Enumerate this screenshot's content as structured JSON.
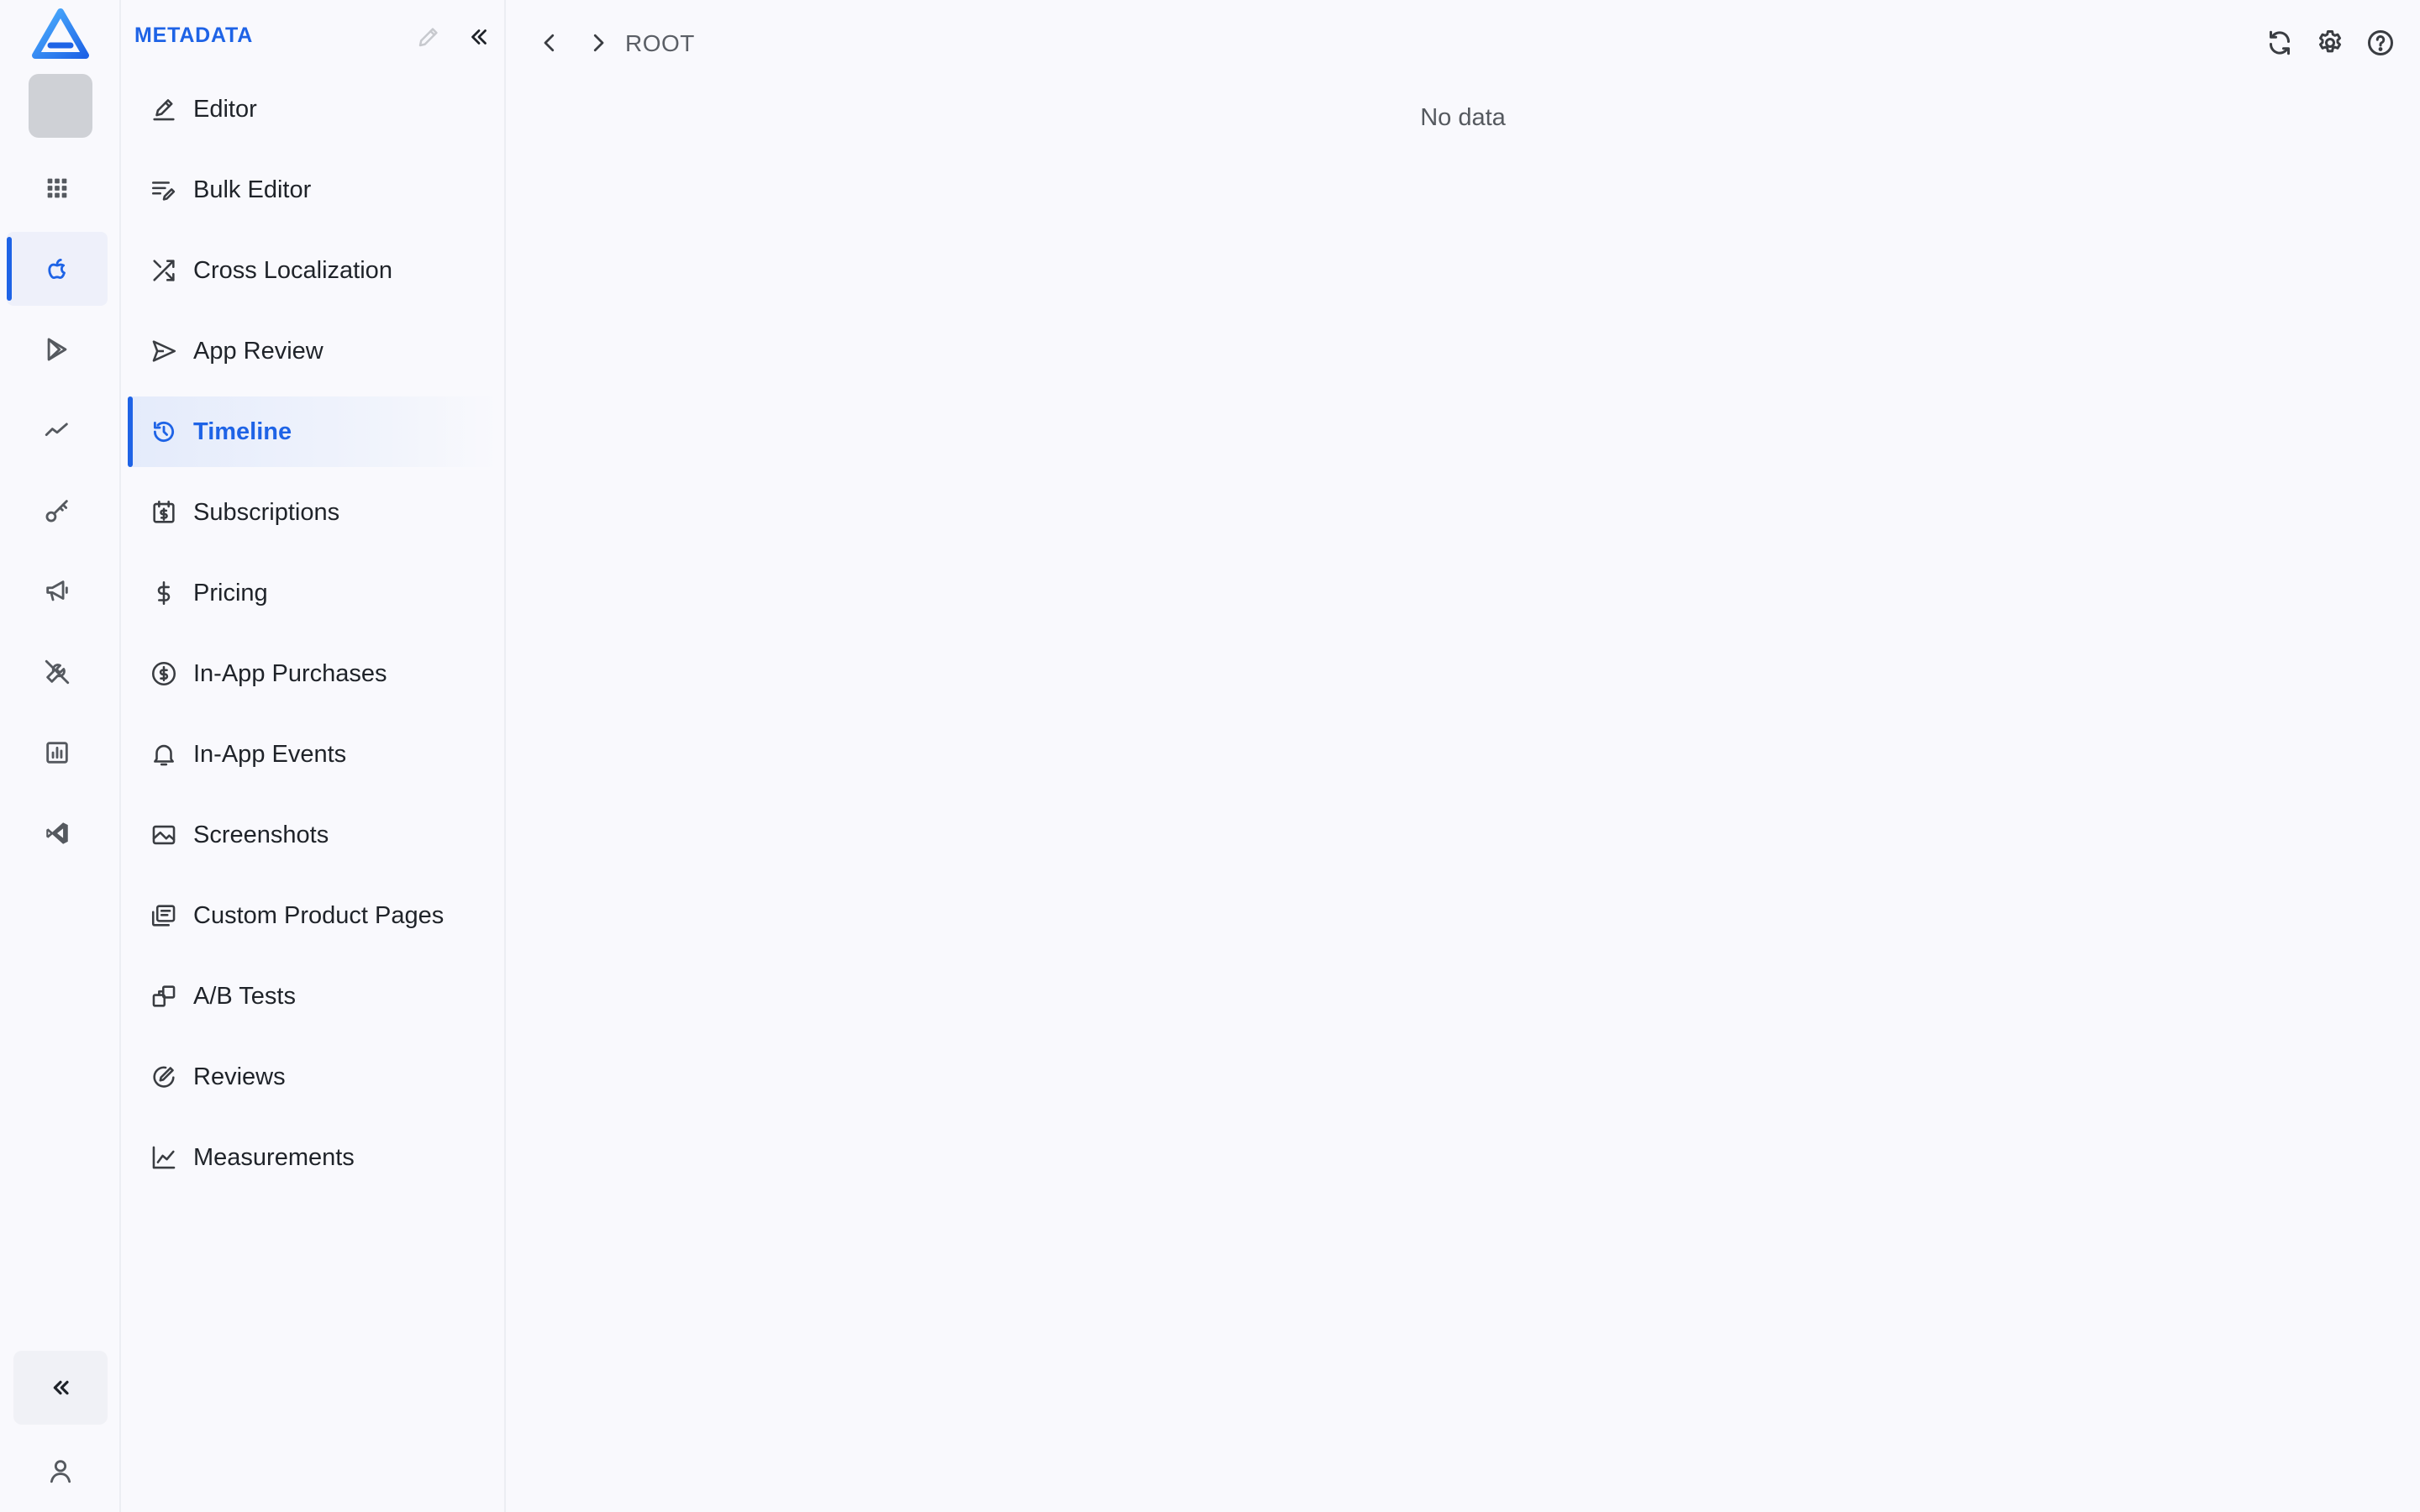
{
  "rail": {
    "logo_icon": "app-logo-icon",
    "items": [
      {
        "icon": "grid-icon",
        "active": false
      },
      {
        "icon": "apple-icon",
        "active": true
      },
      {
        "icon": "google-play-icon",
        "active": false
      },
      {
        "icon": "trend-icon",
        "active": false
      },
      {
        "icon": "key-icon",
        "active": false
      },
      {
        "icon": "megaphone-icon",
        "active": false
      },
      {
        "icon": "tools-icon",
        "active": false
      },
      {
        "icon": "bar-chart-icon",
        "active": false
      },
      {
        "icon": "vscode-icon",
        "active": false
      }
    ],
    "collapse_icon": "chevrons-left-icon",
    "user_icon": "user-icon"
  },
  "panel": {
    "title": "METADATA",
    "items": [
      {
        "label": "Editor",
        "icon": "pen-icon",
        "active": false
      },
      {
        "label": "Bulk Editor",
        "icon": "bulk-edit-icon",
        "active": false
      },
      {
        "label": "Cross Localization",
        "icon": "shuffle-icon",
        "active": false
      },
      {
        "label": "App Review",
        "icon": "send-icon",
        "active": false
      },
      {
        "label": "Timeline",
        "icon": "history-icon",
        "active": true
      },
      {
        "label": "Subscriptions",
        "icon": "subscription-icon",
        "active": false
      },
      {
        "label": "Pricing",
        "icon": "dollar-icon",
        "active": false
      },
      {
        "label": "In-App Purchases",
        "icon": "coin-icon",
        "active": false
      },
      {
        "label": "In-App Events",
        "icon": "bell-icon",
        "active": false
      },
      {
        "label": "Screenshots",
        "icon": "image-icon",
        "active": false
      },
      {
        "label": "Custom Product Pages",
        "icon": "pages-icon",
        "active": false
      },
      {
        "label": "A/B Tests",
        "icon": "ab-test-icon",
        "active": false
      },
      {
        "label": "Reviews",
        "icon": "review-icon",
        "active": false
      },
      {
        "label": "Measurements",
        "icon": "line-chart-icon",
        "active": false
      }
    ]
  },
  "main": {
    "breadcrumb": "ROOT",
    "empty_text": "No data"
  },
  "colors": {
    "accent": "#1e63e6",
    "background": "#f9f9fd",
    "text": "#1f2329",
    "muted": "#5b5f66"
  }
}
